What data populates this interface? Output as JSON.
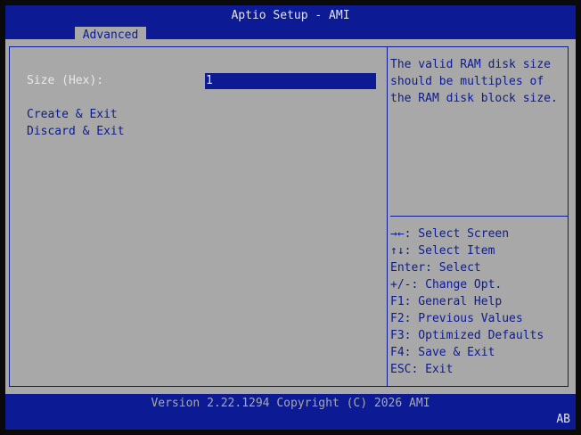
{
  "header": {
    "title": "Aptio Setup - AMI",
    "tabs": [
      {
        "label": "Advanced"
      }
    ]
  },
  "form": {
    "size_label": "Size (Hex):",
    "size_value": "1",
    "actions": [
      {
        "label": "Create & Exit"
      },
      {
        "label": "Discard & Exit"
      }
    ]
  },
  "help": {
    "lines": [
      "The valid RAM disk size",
      "should be multiples of",
      "the RAM disk block size."
    ]
  },
  "keys": [
    "→←: Select Screen",
    "↑↓: Select Item",
    "Enter: Select",
    "+/-: Change Opt.",
    "F1: General Help",
    "F2: Previous Values",
    "F3: Optimized Defaults",
    "F4: Save & Exit",
    "ESC: Exit"
  ],
  "footer": {
    "version": "Version 2.22.1294 Copyright (C) 2026 AMI",
    "badge": "AB"
  },
  "colors": {
    "bios_blue": "#0c1b94",
    "panel_gray": "#a8a8a8",
    "text_white": "#e6e6e6"
  }
}
